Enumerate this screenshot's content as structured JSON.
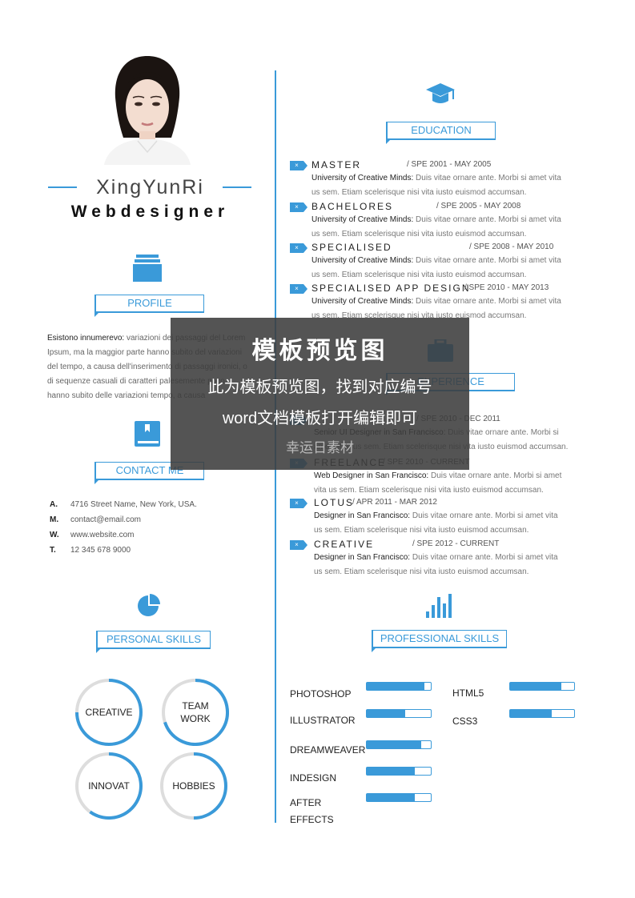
{
  "profile": {
    "name": "XingYunRi",
    "role": "Webdesigner"
  },
  "sections": {
    "education": "EDUCATION",
    "profile": "PROFILE",
    "contact": "CONTACT ME",
    "experience": "EXPERIENCE",
    "personal_skills": "PERSONAL SKILLS",
    "professional_skills": "PROFESSIONAL SKILLS"
  },
  "profile_text": {
    "lead": "Esistono innumerevo:",
    "line1_rest": " variazioni dei passaggi del Lorem",
    "line2": "Ipsum, ma la maggior parte hanno subito del variazioni",
    "line3": "del tempo, a causa dell'inserimento di passaggi ironici, o",
    "line4": "di sequenze casuali di caratteri palesemente poco",
    "line5": "hanno subito delle variazioni tempo, a causa"
  },
  "contact": [
    {
      "key": "A.",
      "value": "4716 Street Name, New York, USA."
    },
    {
      "key": "M.",
      "value": "contact@email.com"
    },
    {
      "key": "W.",
      "value": "www.website.com"
    },
    {
      "key": "T.",
      "value": "12 345 678 9000"
    }
  ],
  "education": [
    {
      "title": "MASTER",
      "date": "/ SPE 2001 - MAY 2005",
      "lead": "University of Creative Minds:",
      "text1": " Duis vitae ornare ante. Morbi si amet vita",
      "text2": "us sem. Etiam scelerisque nisi vita iusto euismod accumsan."
    },
    {
      "title": "BACHELORES",
      "date": "/ SPE 2005 - MAY 2008",
      "lead": "University of Creative Minds:",
      "text1": " Duis vitae ornare ante. Morbi si amet vita",
      "text2": "us sem. Etiam scelerisque nisi vita iusto euismod accumsan."
    },
    {
      "title": "SPECIALISED",
      "date": "/ SPE 2008 - MAY 2010",
      "lead": "University of Creative Minds:",
      "text1": " Duis vitae ornare ante. Morbi si amet vita",
      "text2": "us sem. Etiam scelerisque nisi vita iusto euismod accumsan."
    },
    {
      "title": "SPECIALISED APP DESIGN",
      "date": "/ SPE 2010 - MAY 2013",
      "lead": "University of Creative Minds:",
      "text1": " Duis vitae ornare ante. Morbi si amet vita",
      "text2": "us sem. Etiam scelerisque nisi vita iusto euismod accumsan."
    }
  ],
  "experience": [
    {
      "title": "",
      "date": "/ SPE 2010 - DEC 2011",
      "lead": "Senior UI Designer in San Francisco:",
      "text1": "  Duis vitae ornare ante. Morbi si",
      "text2": "amet vitae us sem. Etiam scelerisque nisi vita iusto euismod accumsan."
    },
    {
      "title": "FREELANCE",
      "date": "/ SPE 2010 - CURRENT",
      "lead": "Web Designer in San Francisco:",
      "text1": " Duis vitae ornare ante. Morbi si amet",
      "text2": "vita us sem. Etiam scelerisque nisi vita iusto euismod accumsan."
    },
    {
      "title": "LOTUS",
      "date": "/ APR 2011 - MAR 2012",
      "lead": "Designer in San Francisco:",
      "text1": " Duis vitae ornare ante. Morbi si amet vita",
      "text2": "us sem. Etiam scelerisque nisi vita iusto euismod accumsan."
    },
    {
      "title": "CREATIVE",
      "date": "/ SPE 2012 - CURRENT",
      "lead": "Designer in San Francisco:",
      "text1": " Duis vitae ornare ante. Morbi si amet vita",
      "text2": "us sem. Etiam scelerisque nisi vita iusto euismod accumsan."
    }
  ],
  "personal_skills": [
    {
      "label1": "CREATIVE",
      "label2": "",
      "level": 0.75
    },
    {
      "label1": "TEAM",
      "label2": "WORK",
      "level": 0.7
    },
    {
      "label1": "INNOVAT",
      "label2": "",
      "level": 0.6
    },
    {
      "label1": "HOBBIES",
      "label2": "",
      "level": 0.5
    }
  ],
  "professional_skills": [
    {
      "name": "PHOTOSHOP",
      "level": 0.9
    },
    {
      "name": "ILLUSTRATOR",
      "level": 0.6
    },
    {
      "name": "DREAMWEAVER",
      "level": 0.85
    },
    {
      "name": "INDESIGN",
      "level": 0.75
    },
    {
      "name": "AFTER",
      "name2": "EFFECTS",
      "level": 0.75
    },
    {
      "name": "HTML5",
      "level": 0.8
    },
    {
      "name": "CSS3",
      "level": 0.65
    }
  ],
  "overlay": {
    "title": "模板预览图",
    "line1": "此为模板预览图，找到对应编号",
    "line2": "word文档模板打开编辑即可",
    "sub": "幸运日素材"
  },
  "colors": {
    "accent": "#3a9ad9"
  },
  "icons": [
    "education-cap-icon",
    "profile-pages-icon",
    "contact-book-icon",
    "experience-briefcase-icon",
    "pie-chart-icon",
    "bar-chart-icon"
  ]
}
